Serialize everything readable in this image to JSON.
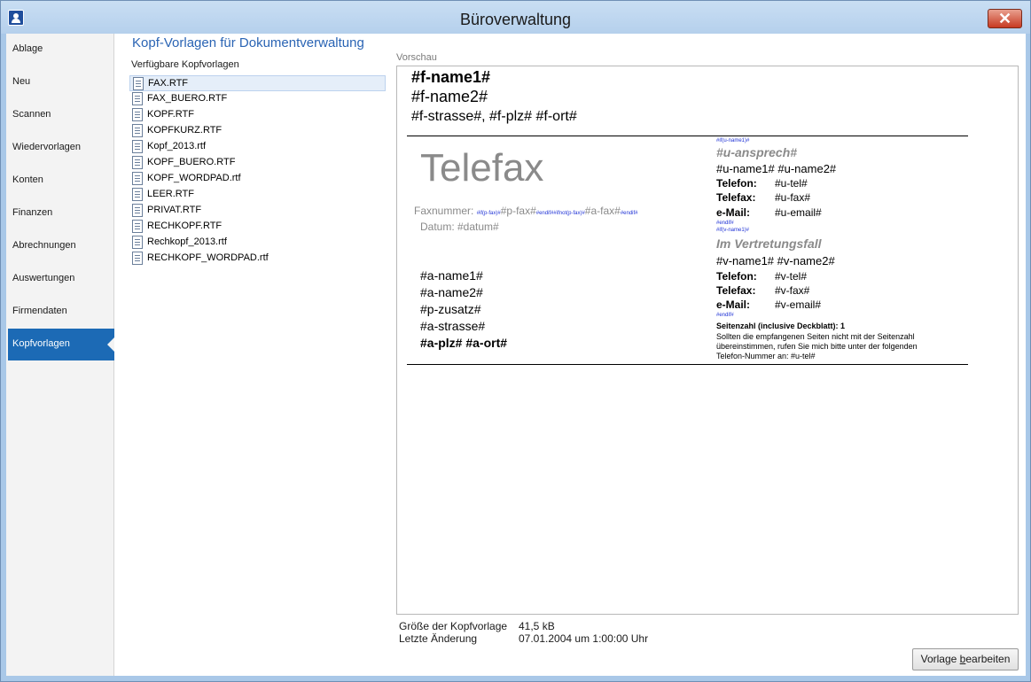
{
  "window": {
    "title": "Büroverwaltung",
    "close_label": "✕"
  },
  "sidebar": {
    "items": [
      {
        "label": "Ablage"
      },
      {
        "label": "Neu"
      },
      {
        "label": "Scannen"
      },
      {
        "label": "Wiedervorlagen"
      },
      {
        "label": "Konten"
      },
      {
        "label": "Finanzen"
      },
      {
        "label": "Abrechnungen"
      },
      {
        "label": "Auswertungen"
      },
      {
        "label": "Firmendaten"
      },
      {
        "label": "Kopfvorlagen",
        "active": true
      }
    ]
  },
  "main": {
    "title": "Kopf-Vorlagen für Dokumentverwaltung",
    "list_label": "Verfügbare Kopfvorlagen",
    "files": [
      "FAX.RTF",
      "FAX_BUERO.RTF",
      "KOPF.RTF",
      "KOPFKURZ.RTF",
      "Kopf_2013.rtf",
      "KOPF_BUERO.RTF",
      "KOPF_WORDPAD.rtf",
      "LEER.RTF",
      "PRIVAT.RTF",
      "RECHKOPF.RTF",
      "Rechkopf_2013.rtf",
      "RECHKOPF_WORDPAD.rtf"
    ],
    "selected_file": "FAX.RTF",
    "preview_label": "Vorschau"
  },
  "preview": {
    "f_name1": "#f-name1#",
    "f_name2": "#f-name2#",
    "f_address": "#f-strasse#, #f-plz# #f-ort#",
    "telefax": "Telefax",
    "faxnummer_label": "Faxnummer:",
    "faxnummer_code1": "#if(p-fax)#",
    "faxnummer_pfax": "#p-fax#",
    "faxnummer_code2": "#endif##ifnot(p-fax)#",
    "faxnummer_afax": "#a-fax#",
    "faxnummer_code3": "#endif#",
    "datum": "Datum: #datum#",
    "a_name1": "#a-name1#",
    "a_name2": "#a-name2#",
    "p_zusatz": "#p-zusatz#",
    "a_strasse": "#a-strasse#",
    "a_plz_ort": "#a-plz# #a-ort#",
    "if_u_name1": "#if(u-name1)#",
    "u_ansprech": "#u-ansprech#",
    "u_names": "#u-name1# #u-name2#",
    "telefon_label": "Telefon:",
    "u_tel": "#u-tel#",
    "telefax_label": "Telefax:",
    "u_fax": "#u-fax#",
    "email_label": "e-Mail:",
    "u_email": "#u-email#",
    "endif1": "#endif#",
    "if_v_name1": "#if(v-name1)#",
    "vertretung": "Im Vertretungsfall",
    "v_names": "#v-name1# #v-name2#",
    "v_tel": "#v-tel#",
    "v_fax": "#v-fax#",
    "v_email": "#v-email#",
    "endif2": "#endif#",
    "seitenzahl": "Seitenzahl (inclusive Deckblatt): 1",
    "hinweis1": "Sollten die empfangenen Seiten nicht mit der Seitenzahl",
    "hinweis2": "übereinstimmen, rufen Sie mich bitte unter der folgenden",
    "hinweis3": "Telefon-Nummer an: #u-tel#"
  },
  "info": {
    "size_label": "Größe der Kopfvorlage",
    "size_value": "41,5 kB",
    "changed_label": "Letzte Änderung",
    "changed_value": "07.01.2004 um  1:00:00 Uhr"
  },
  "buttons": {
    "edit_prefix": "Vorlage ",
    "edit_underlined": "b",
    "edit_rest": "earbeiten"
  }
}
